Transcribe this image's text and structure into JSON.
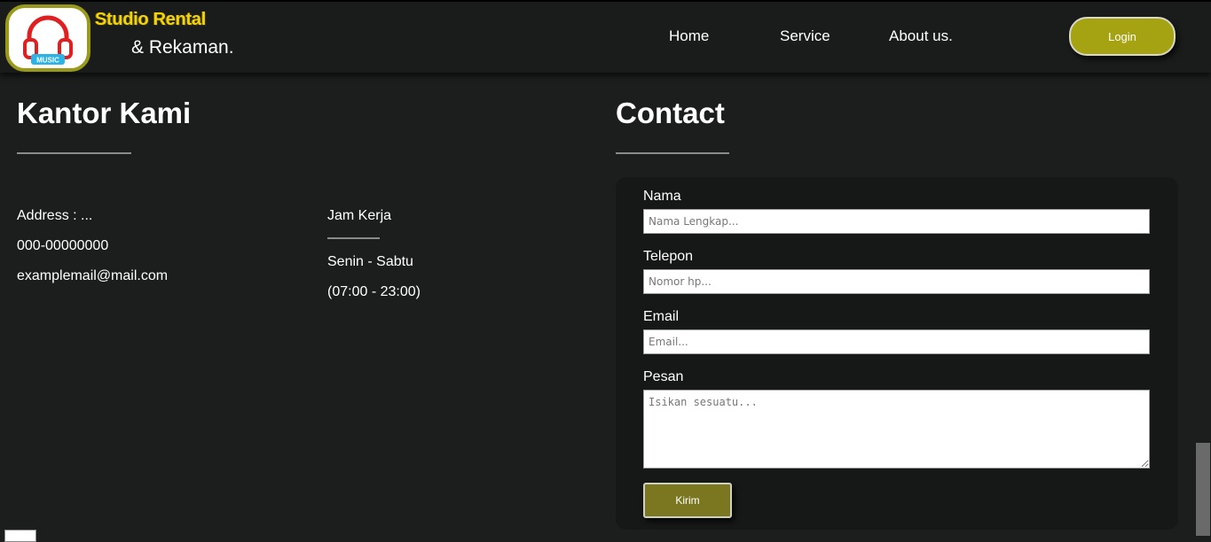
{
  "brand": {
    "title": "Studio Rental",
    "subtitle": "& Rekaman.",
    "logo_text": "MUSIC"
  },
  "nav": {
    "items": [
      {
        "label": "Home"
      },
      {
        "label": "Service"
      },
      {
        "label": "About us."
      }
    ],
    "login_label": "Login"
  },
  "office": {
    "heading": "Kantor Kami",
    "address": "Address : ...",
    "phone": "000-00000000",
    "email": "examplemail@mail.com",
    "hours_title": "Jam Kerja",
    "hours_days": "Senin - Sabtu",
    "hours_time": "(07:00 - 23:00)"
  },
  "contact": {
    "heading": "Contact",
    "fields": [
      {
        "label": "Nama",
        "placeholder": "Nama Lengkap..."
      },
      {
        "label": "Telepon",
        "placeholder": "Nomor hp..."
      },
      {
        "label": "Email",
        "placeholder": "Email..."
      }
    ],
    "message_label": "Pesan",
    "message_placeholder": "Isikan sesuatu...",
    "submit_label": "Kirim"
  },
  "colors": {
    "accent": "#a6a312",
    "submit": "#7a7720",
    "background": "#1c1e1e",
    "logo_title": "#f4d400"
  }
}
